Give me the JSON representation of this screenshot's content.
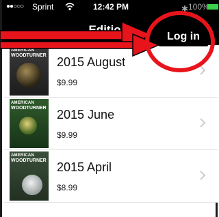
{
  "status_bar": {
    "signal": "●●○○○",
    "carrier": "Sprint",
    "time": "12:42 PM",
    "battery": "100%"
  },
  "nav": {
    "title": "Editions",
    "login_label": "Log in"
  },
  "editions": [
    {
      "title": "2015 August",
      "price": "$9.99",
      "cover_masthead": "AMERICAN",
      "cover_brand": "WOODTURNER"
    },
    {
      "title": "2015 June",
      "price": "$9.99",
      "cover_masthead": "AMERICAN",
      "cover_brand": "WOODTURNER"
    },
    {
      "title": "2015 April",
      "price": "$8.99",
      "cover_masthead": "AMERICAN",
      "cover_brand": "WOODTURNER"
    }
  ],
  "colors": {
    "annotation_red": "#e8141c",
    "battery_green": "#3bd14c"
  },
  "icons": [
    "wifi-icon",
    "bluetooth-icon",
    "battery-icon",
    "chevron-right-icon"
  ]
}
